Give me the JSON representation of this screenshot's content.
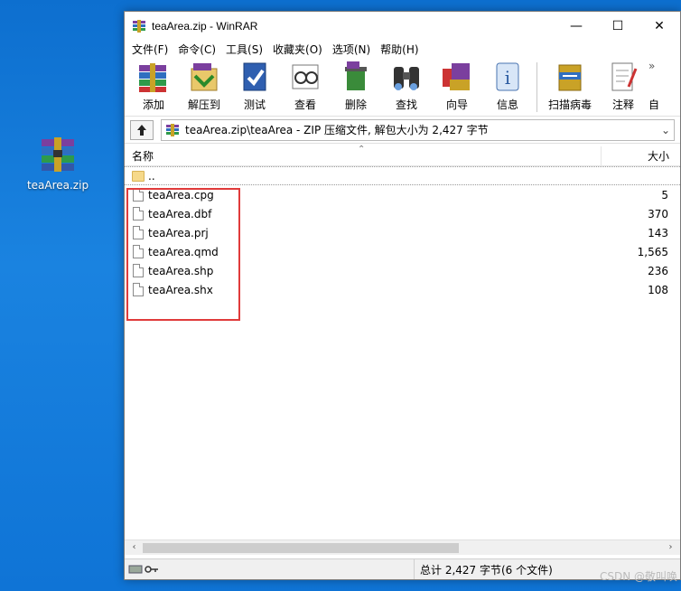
{
  "desktop": {
    "icon_label": "teaArea.zip"
  },
  "window": {
    "title": "teaArea.zip - WinRAR",
    "controls": {
      "minimize": "—",
      "maximize": "☐",
      "close": "✕"
    }
  },
  "menu": [
    "文件(F)",
    "命令(C)",
    "工具(S)",
    "收藏夹(O)",
    "选项(N)",
    "帮助(H)"
  ],
  "toolbar": [
    {
      "label": "添加",
      "icon": "add-books-icon"
    },
    {
      "label": "解压到",
      "icon": "extract-to-icon"
    },
    {
      "label": "测试",
      "icon": "test-icon"
    },
    {
      "label": "查看",
      "icon": "view-icon"
    },
    {
      "label": "删除",
      "icon": "delete-icon"
    },
    {
      "label": "查找",
      "icon": "find-icon"
    },
    {
      "label": "向导",
      "icon": "wizard-icon"
    },
    {
      "label": "信息",
      "icon": "info-icon"
    },
    {
      "label": "扫描病毒",
      "icon": "scan-virus-icon"
    },
    {
      "label": "注释",
      "icon": "comment-icon"
    },
    {
      "label": "自",
      "icon": "sfx-icon"
    }
  ],
  "address": {
    "path": "teaArea.zip\\teaArea - ZIP 压缩文件, 解包大小为 2,427 字节"
  },
  "list": {
    "columns": {
      "name": "名称",
      "size": "大小"
    },
    "parent": "..",
    "files": [
      {
        "name": "teaArea.cpg",
        "size": "5"
      },
      {
        "name": "teaArea.dbf",
        "size": "370"
      },
      {
        "name": "teaArea.prj",
        "size": "143"
      },
      {
        "name": "teaArea.qmd",
        "size": "1,565"
      },
      {
        "name": "teaArea.shp",
        "size": "236"
      },
      {
        "name": "teaArea.shx",
        "size": "108"
      }
    ]
  },
  "status": {
    "text": "总计 2,427 字节(6 个文件)"
  },
  "watermark": "CSDN @敬叫唤",
  "colors": {
    "highlight": "#e03b3b",
    "desktop": "#1a83e0"
  }
}
